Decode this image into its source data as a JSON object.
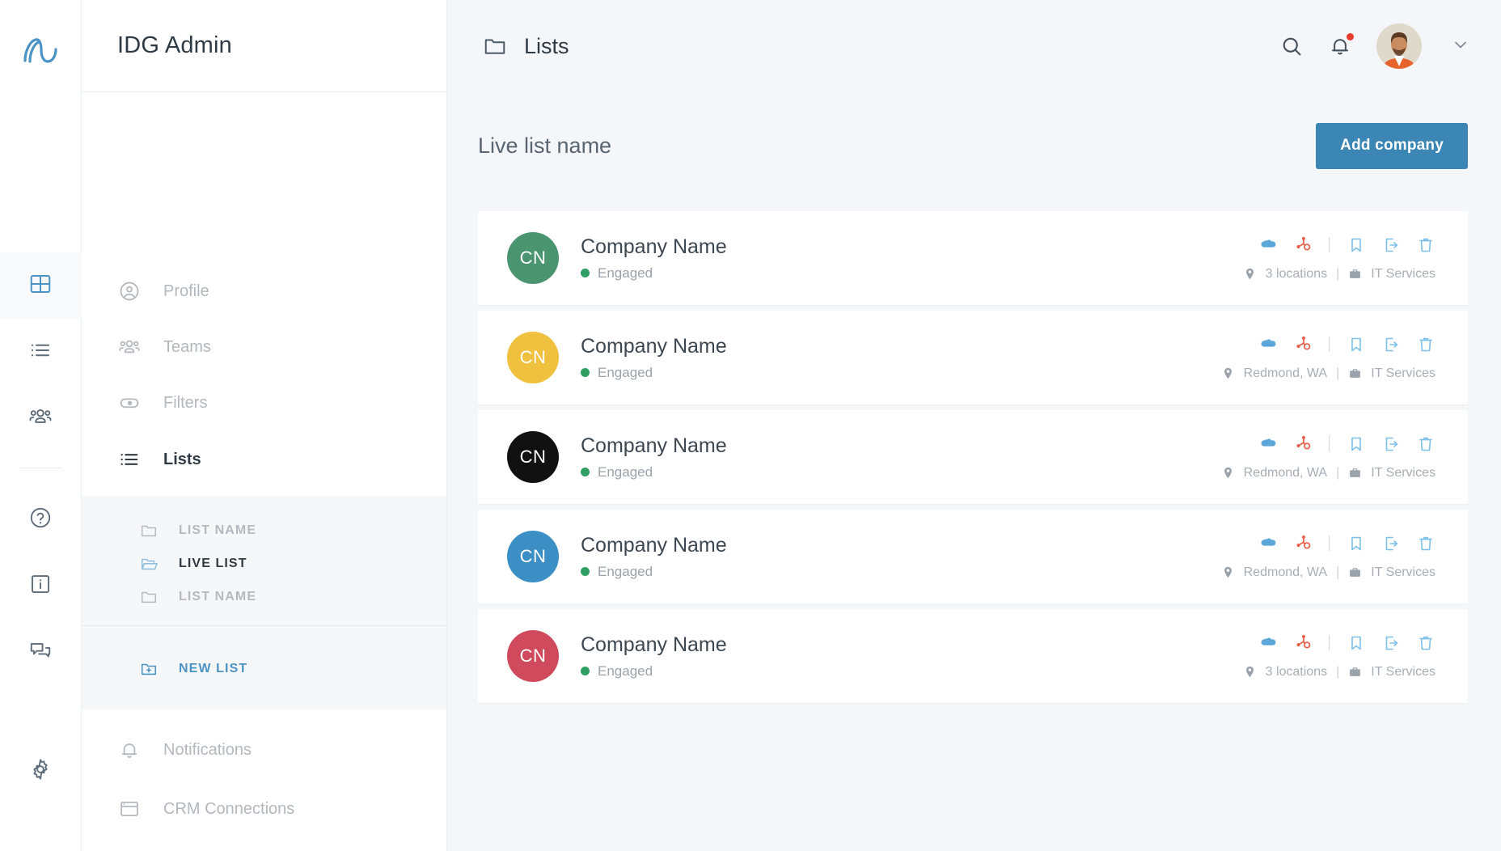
{
  "brand": {
    "logo_icon": "mapped-logo-icon",
    "accent": "#4a93c4"
  },
  "rail": {
    "items": [
      {
        "name": "grid",
        "icon": "grid-icon",
        "active": true
      },
      {
        "name": "list",
        "icon": "list-icon",
        "active": false
      },
      {
        "name": "people",
        "icon": "people-icon",
        "active": false
      }
    ],
    "items_bottom": [
      {
        "name": "help",
        "icon": "help-circle-icon"
      },
      {
        "name": "info",
        "icon": "info-box-icon"
      },
      {
        "name": "chat",
        "icon": "chat-bubbles-icon"
      }
    ],
    "settings": {
      "name": "settings",
      "icon": "gear-icon"
    }
  },
  "sidebar": {
    "title": "IDG Admin",
    "items": [
      {
        "label": "Profile",
        "icon": "user-circle-icon",
        "active": false
      },
      {
        "label": "Teams",
        "icon": "people-icon",
        "active": false
      },
      {
        "label": "Filters",
        "icon": "toggle-icon",
        "active": false
      },
      {
        "label": "Lists",
        "icon": "list-icon",
        "active": true
      }
    ],
    "sublists": [
      {
        "label": "LIST NAME",
        "icon": "folder-icon",
        "current": false
      },
      {
        "label": "LIVE LIST",
        "icon": "folder-open-icon",
        "current": true
      },
      {
        "label": "LIST NAME",
        "icon": "folder-icon",
        "current": false
      }
    ],
    "new_list": {
      "label": "NEW LIST",
      "icon": "folder-plus-icon"
    },
    "footer_items": [
      {
        "label": "Notifications",
        "icon": "bell-icon"
      },
      {
        "label": "CRM Connections",
        "icon": "browser-window-icon"
      }
    ]
  },
  "topbar": {
    "title": "Lists",
    "title_icon": "folder-icon",
    "search_icon": "search-icon",
    "bell_icon": "bell-icon",
    "bell_badge": true,
    "avatar_icon": "avatar",
    "chevron_icon": "chevron-down-icon"
  },
  "main": {
    "list_name": "Live list name",
    "add_button": "Add company",
    "add_button_color": "#3b86b5",
    "row_actions": [
      {
        "name": "salesforce",
        "icon": "salesforce-cloud-icon",
        "color": "#5ba7d9"
      },
      {
        "name": "hubspot",
        "icon": "hubspot-icon",
        "color": "#e8604c"
      },
      {
        "name": "bookmark",
        "icon": "bookmark-icon",
        "color": "#7cc0e8"
      },
      {
        "name": "export",
        "icon": "export-icon",
        "color": "#7cc0e8"
      },
      {
        "name": "delete",
        "icon": "trash-icon",
        "color": "#7cc0e8"
      }
    ],
    "companies": [
      {
        "initials": "CN",
        "name": "Company Name",
        "status": "Engaged",
        "status_color": "#2e9e62",
        "avatar_color": "#4a9470",
        "location": "3 locations",
        "industry": "IT Services"
      },
      {
        "initials": "CN",
        "name": "Company Name",
        "status": "Engaged",
        "status_color": "#2e9e62",
        "avatar_color": "#efc13f",
        "location": "Redmond, WA",
        "industry": "IT Services"
      },
      {
        "initials": "CN",
        "name": "Company Name",
        "status": "Engaged",
        "status_color": "#2e9e62",
        "avatar_color": "#111111",
        "location": "Redmond, WA",
        "industry": "IT Services"
      },
      {
        "initials": "CN",
        "name": "Company Name",
        "status": "Engaged",
        "status_color": "#2e9e62",
        "avatar_color": "#3b8fc4",
        "location": "Redmond, WA",
        "industry": "IT Services"
      },
      {
        "initials": "CN",
        "name": "Company Name",
        "status": "Engaged",
        "status_color": "#2e9e62",
        "avatar_color": "#cf4a5c",
        "location": "3 locations",
        "industry": "IT Services"
      }
    ]
  }
}
